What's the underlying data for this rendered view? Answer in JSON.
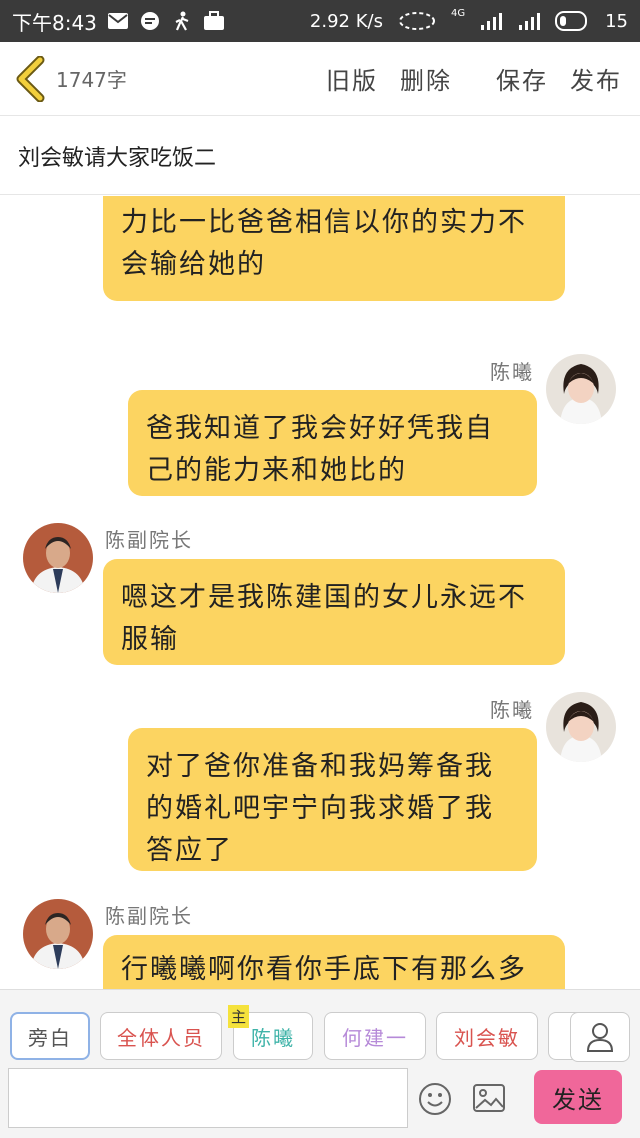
{
  "status_bar": {
    "time": "下午8:43",
    "speed": "2.92 K/s",
    "network": "4G",
    "battery": "15",
    "icons": [
      "mail-icon",
      "chat-icon",
      "walking-icon",
      "briefcase-icon",
      "alarm-icon",
      "signal-icon",
      "battery-icon"
    ]
  },
  "header": {
    "word_count": "1747字",
    "old_version": "旧版",
    "delete": "删除",
    "save": "保存",
    "publish": "发布"
  },
  "title": "刘会敏请大家吃饭二",
  "messages": [
    {
      "side": "left",
      "sender": "",
      "text": "爸爸其实应该让你和刘会敏用实力比一比爸爸相信以你的实力不会输给她的"
    },
    {
      "side": "right",
      "sender": "陈曦",
      "text": "爸我知道了我会好好凭我自己的能力来和她比的"
    },
    {
      "side": "left",
      "sender": "陈副院长",
      "text": "嗯这才是我陈建国的女儿永远不服输"
    },
    {
      "side": "right",
      "sender": "陈曦",
      "text": "对了爸你准备和我妈筹备我的婚礼吧宇宁向我求婚了我答应了"
    },
    {
      "side": "left",
      "sender": "陈副院长",
      "text": "行曦曦啊你看你手底下有那么多人"
    }
  ],
  "roles": [
    {
      "label": "旁白",
      "color": "#555555"
    },
    {
      "label": "全体人员",
      "color": "#d9534f"
    },
    {
      "label": "陈曦",
      "color": "#3fb3a8",
      "tag": "主"
    },
    {
      "label": "何建一",
      "color": "#b68ad8"
    },
    {
      "label": "刘会敏",
      "color": "#d9534f"
    }
  ],
  "input": {
    "placeholder": ""
  },
  "send_label": "发送",
  "colors": {
    "bubble": "#fcd461",
    "send": "#f0679a",
    "status_bar": "#3a3a3a",
    "back_arrow": "#f2cf3c"
  }
}
